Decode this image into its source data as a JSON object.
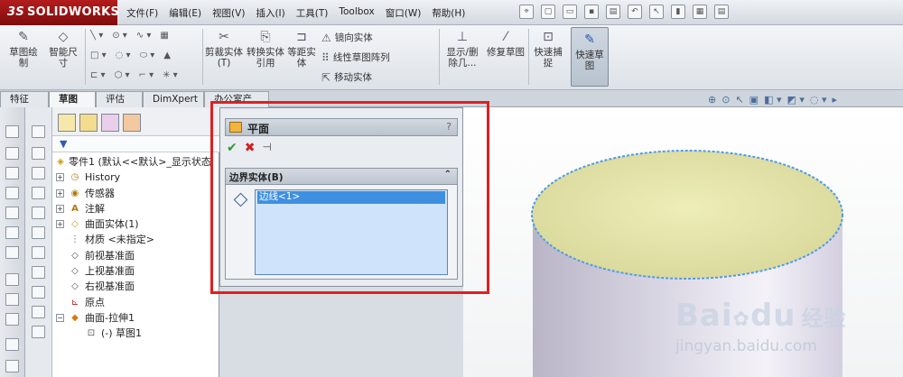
{
  "app": {
    "logo_text": "SOLIDWORKS",
    "logo_prefix": "3S"
  },
  "menu": [
    "文件(F)",
    "编辑(E)",
    "视图(V)",
    "插入(I)",
    "工具(T)",
    "Toolbox",
    "窗口(W)",
    "帮助(H)"
  ],
  "toolbar": {
    "sketch": "草图绘制",
    "smart_dim": "智能尺寸",
    "trim": "剪裁实体(T)",
    "convert": "转换实体引用",
    "offset": "等距实体",
    "mirror": "镜向实体",
    "linear_pattern": "线性草图阵列",
    "move": "移动实体",
    "show_delete": "显示/删除几...",
    "repair": "修复草图",
    "rapid_snaps": "快速捕捉",
    "rapid_sketch": "快速草图"
  },
  "tabs": [
    "特征",
    "草图",
    "评估",
    "DimXpert",
    "办公室产品"
  ],
  "active_tab": "草图",
  "tree": {
    "root": "零件1 (默认<<默认>_显示状态",
    "items": [
      {
        "label": "History",
        "icon": "history-icon"
      },
      {
        "label": "传感器",
        "icon": "sensor-icon"
      },
      {
        "label": "注解",
        "icon": "annotation-icon"
      },
      {
        "label": "曲面实体(1)",
        "icon": "surface-body-icon"
      },
      {
        "label": "材质 <未指定>",
        "icon": "material-icon"
      },
      {
        "label": "前视基准面",
        "icon": "plane-icon"
      },
      {
        "label": "上视基准面",
        "icon": "plane-icon"
      },
      {
        "label": "右视基准面",
        "icon": "plane-icon"
      },
      {
        "label": "原点",
        "icon": "origin-icon"
      },
      {
        "label": "曲面-拉伸1",
        "icon": "surface-extrude-icon"
      },
      {
        "label": "(-) 草图1",
        "icon": "sketch-icon"
      }
    ]
  },
  "property_manager": {
    "title": "平面",
    "help": "?",
    "group_title": "边界实体(B)",
    "selection": "边线<1>"
  },
  "watermark": {
    "brand": "Bai",
    "brand2": "du",
    "brand_cn": "经验",
    "url": "jingyan.baidu.com"
  },
  "colors": {
    "accent_red": "#e02020",
    "selection_blue": "#3f8fe0",
    "cylinder_top": "#e7e6a8",
    "cylinder_side": "#c9c6d8"
  }
}
